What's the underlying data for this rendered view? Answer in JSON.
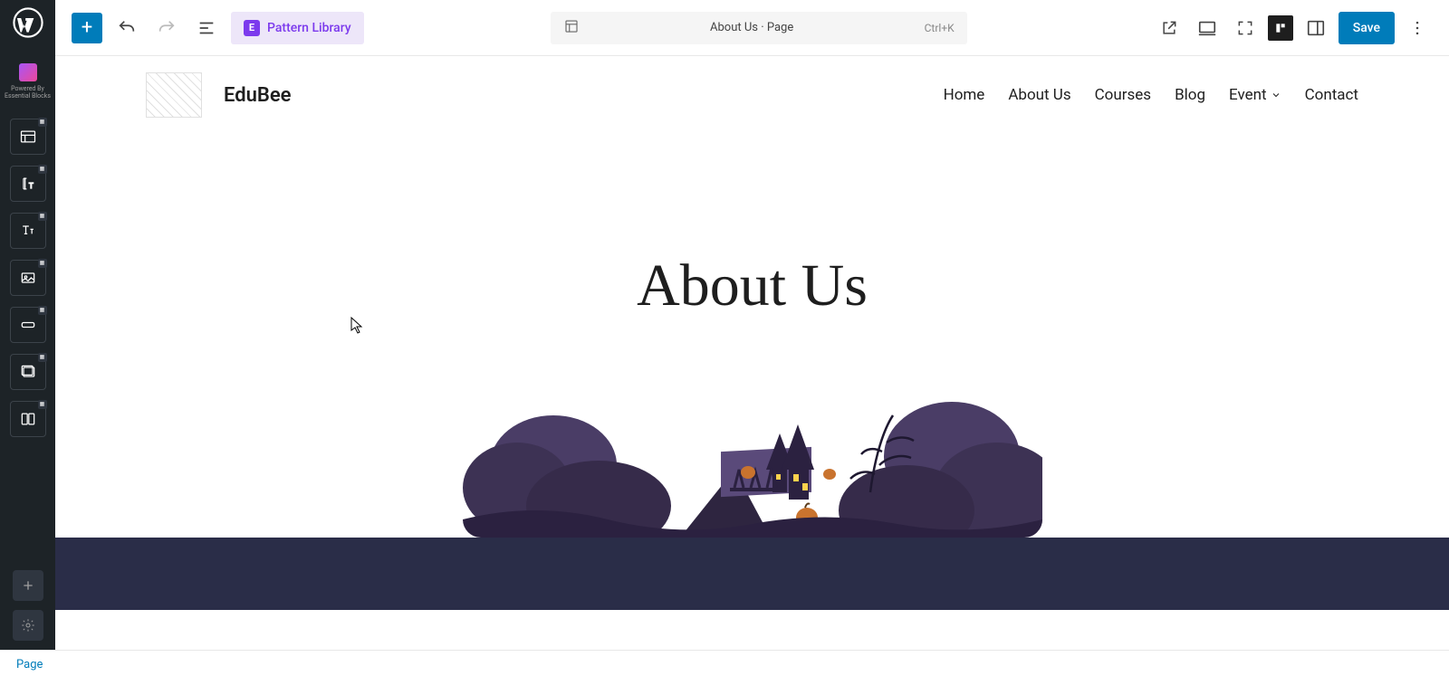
{
  "sidebar": {
    "powered_by": "Powered By",
    "essential_blocks": "Essential Blocks"
  },
  "toolbar": {
    "pattern_library": "Pattern Library",
    "doc_title": "About Us · Page",
    "shortcut": "Ctrl+K",
    "save": "Save"
  },
  "page": {
    "brand": "EduBee",
    "nav": [
      "Home",
      "About Us",
      "Courses",
      "Blog",
      "Event",
      "Contact"
    ],
    "hero_title": "About Us"
  },
  "breadcrumb": "Page"
}
